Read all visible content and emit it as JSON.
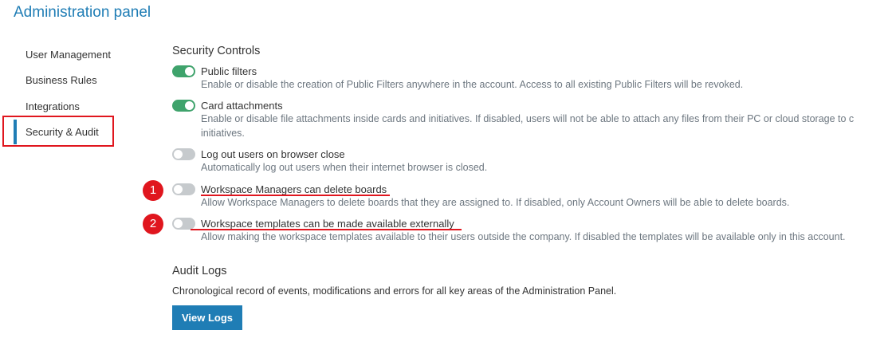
{
  "header": {
    "title": "Administration panel"
  },
  "sidebar": {
    "items": [
      {
        "label": "User Management"
      },
      {
        "label": "Business Rules"
      },
      {
        "label": "Integrations"
      },
      {
        "label": "Security & Audit",
        "active": true
      }
    ]
  },
  "security": {
    "title": "Security Controls",
    "settings": [
      {
        "label": "Public filters",
        "description": "Enable or disable the creation of Public Filters anywhere in the account. Access to all existing Public Filters will be revoked.",
        "enabled": true
      },
      {
        "label": "Card attachments",
        "description": "Enable or disable file attachments inside cards and initiatives. If disabled, users will not be able to attach any files from their PC or cloud storage to c",
        "description_line2": "initiatives.",
        "enabled": true
      },
      {
        "label": "Log out users on browser close",
        "description": "Automatically log out users when their internet browser is closed.",
        "enabled": false
      },
      {
        "label": "Workspace Managers can delete boards",
        "description": "Allow Workspace Managers to delete boards that they are assigned to. If disabled, only Account Owners will be able to delete boards.",
        "enabled": false,
        "annotation": "1"
      },
      {
        "label": "Workspace templates can be made available externally",
        "description": "Allow making the workspace templates available to their users outside the company. If disabled the templates will be available only in this account.",
        "enabled": false,
        "annotation": "2"
      }
    ]
  },
  "audit": {
    "title": "Audit Logs",
    "description": "Chronological record of events, modifications and errors for all key areas of the Administration Panel.",
    "button_label": "View Logs"
  },
  "colors": {
    "accent": "#1f7db5",
    "toggle_on": "#3fa36c",
    "toggle_off": "#c6cacd",
    "annotation_red": "#e0161e"
  }
}
